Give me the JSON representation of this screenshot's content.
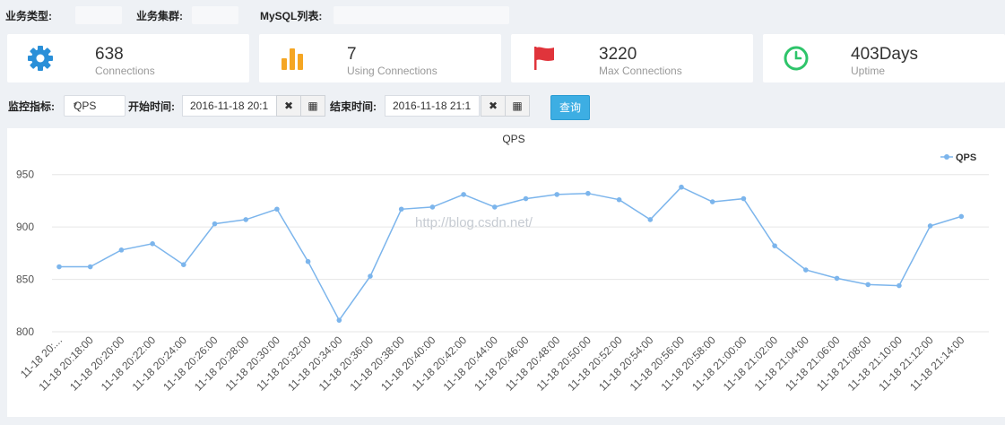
{
  "filters": {
    "business_type_label": "业务类型:",
    "business_group_label": "业务集群:",
    "mysql_list_label": "MySQL列表:"
  },
  "stats": [
    {
      "value": "638",
      "label": "Connections",
      "icon": "gear-icon",
      "color": "#2a8fd8"
    },
    {
      "value": "7",
      "label": "Using Connections",
      "icon": "bar-chart-icon",
      "color": "#f5a623"
    },
    {
      "value": "3220",
      "label": "Max Connections",
      "icon": "flag-icon",
      "color": "#e0343b"
    },
    {
      "value": "403Days",
      "label": "Uptime",
      "icon": "clock-icon",
      "color": "#2ec46a"
    }
  ],
  "controls": {
    "metric_label": "监控指标:",
    "metric_value": "QPS",
    "start_label": "开始时间:",
    "start_value": "2016-11-18 20:1",
    "end_label": "结束时间:",
    "end_value": "2016-11-18 21:1",
    "clear_glyph": "✖",
    "calendar_glyph": "▦",
    "query_label": "查询"
  },
  "chart_data": {
    "type": "line",
    "title": "QPS",
    "watermark": "http://blog.csdn.net/",
    "legend_position": "top-right",
    "grid": true,
    "ylim": [
      800,
      960
    ],
    "yticks": [
      800,
      850,
      900,
      950
    ],
    "color": "#7cb5ec",
    "categories": [
      "11-18 20:...",
      "11-18 20:18:00",
      "11-18 20:20:00",
      "11-18 20:22:00",
      "11-18 20:24:00",
      "11-18 20:26:00",
      "11-18 20:28:00",
      "11-18 20:30:00",
      "11-18 20:32:00",
      "11-18 20:34:00",
      "11-18 20:36:00",
      "11-18 20:38:00",
      "11-18 20:40:00",
      "11-18 20:42:00",
      "11-18 20:44:00",
      "11-18 20:46:00",
      "11-18 20:48:00",
      "11-18 20:50:00",
      "11-18 20:52:00",
      "11-18 20:54:00",
      "11-18 20:56:00",
      "11-18 20:58:00",
      "11-18 21:00:00",
      "11-18 21:02:00",
      "11-18 21:04:00",
      "11-18 21:06:00",
      "11-18 21:08:00",
      "11-18 21:10:00",
      "11-18 21:12:00",
      "11-18 21:14:00"
    ],
    "series": [
      {
        "name": "QPS",
        "values": [
          862,
          862,
          878,
          884,
          864,
          903,
          907,
          917,
          867,
          811,
          853,
          917,
          919,
          931,
          919,
          927,
          931,
          932,
          926,
          907,
          938,
          924,
          927,
          882,
          859,
          851,
          845,
          844,
          901,
          910
        ]
      }
    ]
  }
}
